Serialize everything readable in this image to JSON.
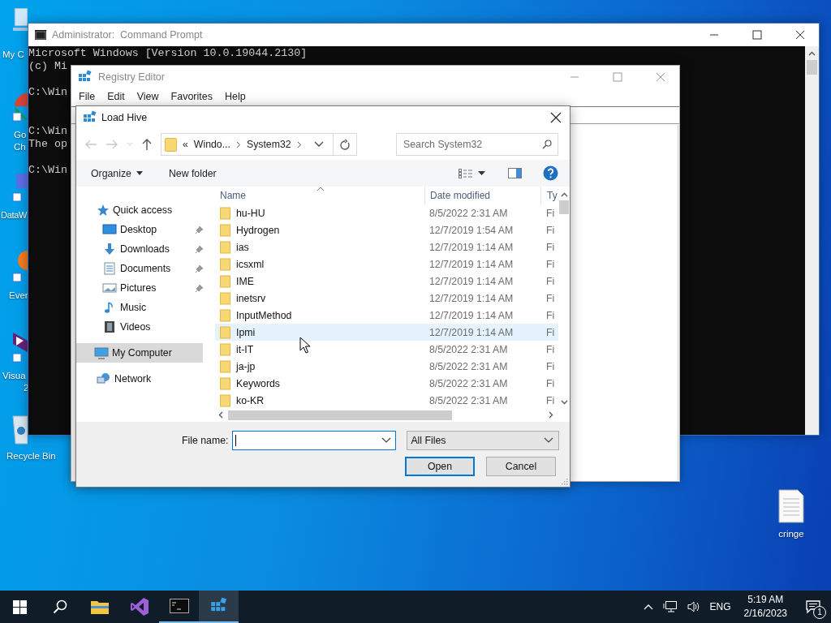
{
  "desktop_icons": [
    {
      "kind": "computer",
      "lines": [
        "My C"
      ]
    },
    {
      "kind": "browser",
      "lines": [
        "Go",
        "Ch"
      ]
    },
    {
      "kind": "data-app",
      "lines": [
        "DataW"
      ]
    },
    {
      "kind": "note-app",
      "lines": [
        "Ever"
      ]
    },
    {
      "kind": "studio",
      "lines": [
        "Visua",
        "2"
      ]
    },
    {
      "kind": "recycle-bin",
      "lines": [
        "Recycle Bin"
      ]
    }
  ],
  "desktop_file": {
    "kind": "text-file",
    "lines": [
      "cringe"
    ]
  },
  "command_prompt": {
    "title": "Administrator:  Command Prompt",
    "lines": [
      "Microsoft Windows [Version 10.0.19044.2130]",
      "(c) Mi",
      "C:\\Win",
      "C:\\Win",
      "The op",
      "C:\\Win"
    ]
  },
  "registry_editor": {
    "title": "Registry Editor",
    "menu": [
      "File",
      "Edit",
      "View",
      "Favorites",
      "Help"
    ]
  },
  "dialog": {
    "title": "Load Hive",
    "breadcrumb": {
      "overflow": "«",
      "parts": [
        "Windo...",
        "System32"
      ]
    },
    "search": {
      "placeholder": "Search System32"
    },
    "toolbar": {
      "organize": "Organize",
      "new_folder": "New folder"
    },
    "nav": [
      {
        "label": "Quick access",
        "kind": "star",
        "selected": false,
        "children": [
          {
            "label": "Desktop",
            "kind": "desktop",
            "selected": false,
            "pinned": true
          },
          {
            "label": "Downloads",
            "kind": "downloads",
            "selected": false,
            "pinned": true
          },
          {
            "label": "Documents",
            "kind": "documents",
            "selected": false,
            "pinned": true
          },
          {
            "label": "Pictures",
            "kind": "pictures",
            "selected": false,
            "pinned": true
          },
          {
            "label": "Music",
            "kind": "music",
            "selected": false,
            "pinned": false
          },
          {
            "label": "Videos",
            "kind": "videos",
            "selected": false,
            "pinned": false
          }
        ]
      },
      {
        "label": "My Computer",
        "kind": "computer",
        "selected": true
      },
      {
        "label": "Network",
        "kind": "network",
        "selected": false
      }
    ],
    "columns": [
      "Name",
      "Date modified",
      "Ty"
    ],
    "rows": [
      {
        "name": "hu-HU",
        "date": "8/5/2022 2:31 AM",
        "type": "Fi",
        "hovered": false
      },
      {
        "name": "Hydrogen",
        "date": "12/7/2019 1:54 AM",
        "type": "Fi",
        "hovered": false
      },
      {
        "name": "ias",
        "date": "12/7/2019 1:14 AM",
        "type": "Fi",
        "hovered": false
      },
      {
        "name": "icsxml",
        "date": "12/7/2019 1:14 AM",
        "type": "Fi",
        "hovered": false
      },
      {
        "name": "IME",
        "date": "12/7/2019 1:14 AM",
        "type": "Fi",
        "hovered": false
      },
      {
        "name": "inetsrv",
        "date": "12/7/2019 1:14 AM",
        "type": "Fi",
        "hovered": false
      },
      {
        "name": "InputMethod",
        "date": "12/7/2019 1:14 AM",
        "type": "Fi",
        "hovered": false
      },
      {
        "name": "Ipmi",
        "date": "12/7/2019 1:14 AM",
        "type": "Fi",
        "hovered": true
      },
      {
        "name": "it-IT",
        "date": "8/5/2022 2:31 AM",
        "type": "Fi",
        "hovered": false
      },
      {
        "name": "ja-jp",
        "date": "8/5/2022 2:31 AM",
        "type": "Fi",
        "hovered": false
      },
      {
        "name": "Keywords",
        "date": "8/5/2022 2:31 AM",
        "type": "Fi",
        "hovered": false
      },
      {
        "name": "ko-KR",
        "date": "8/5/2022 2:31 AM",
        "type": "Fi",
        "hovered": false
      }
    ],
    "file_name": {
      "label": "File name:"
    },
    "file_type": "All Files",
    "buttons": [
      {
        "label": "Open",
        "kind": "default"
      },
      {
        "label": "Cancel",
        "kind": "normal"
      }
    ]
  },
  "taskbar": {
    "apps": [
      {
        "kind": "start",
        "running": false,
        "selected": false
      },
      {
        "kind": "search",
        "running": false,
        "selected": false
      },
      {
        "kind": "explorer",
        "running": false,
        "selected": false
      },
      {
        "kind": "studio",
        "running": false,
        "selected": false
      },
      {
        "kind": "console",
        "running": true,
        "selected": false
      },
      {
        "kind": "registry",
        "running": true,
        "selected": true
      }
    ],
    "language": "ENG",
    "time": "5:19 AM",
    "date": "2/16/2023",
    "notifications": "1"
  }
}
